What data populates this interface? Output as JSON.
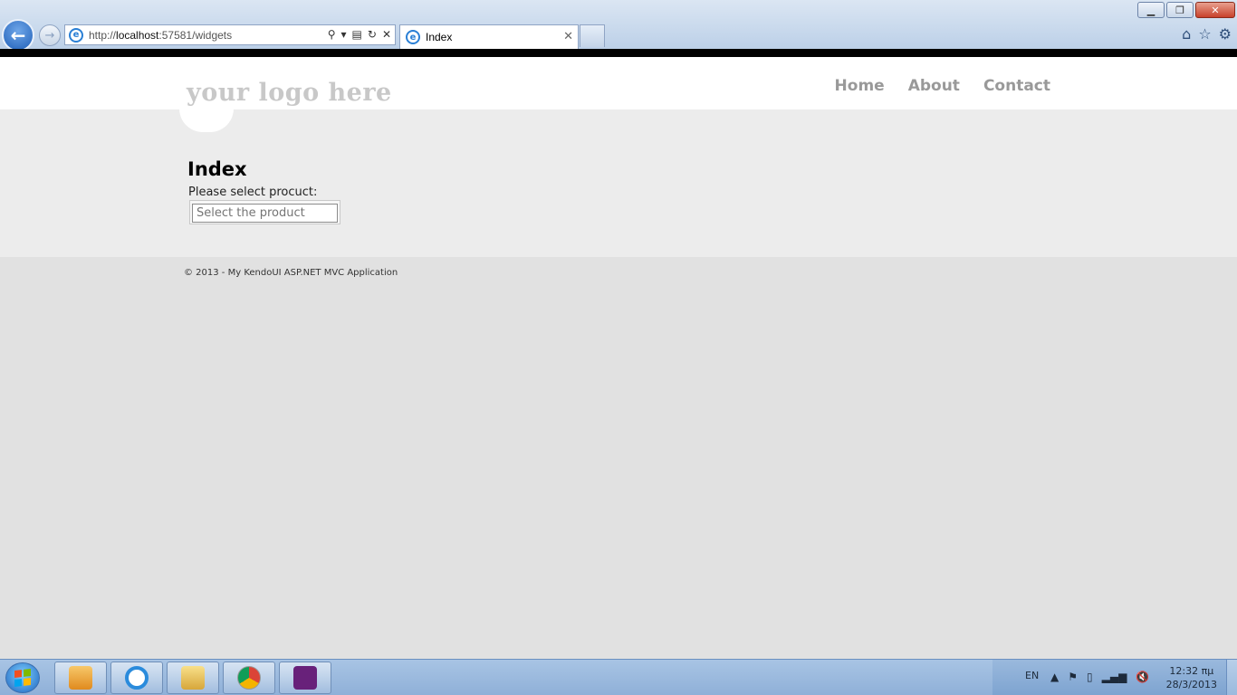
{
  "browser": {
    "url_prefix": "http://",
    "url_host": "localhost",
    "url_rest": ":57581/widgets",
    "tab_title": "Index"
  },
  "site": {
    "logo": "your logo here",
    "menu": [
      "Home",
      "About",
      "Contact"
    ]
  },
  "main": {
    "title": "Index",
    "label": "Please select procuct:",
    "select_placeholder": "Select the product"
  },
  "footer": {
    "text": "© 2013 - My KendoUI ASP.NET MVC Application"
  },
  "taskbar": {
    "lang": "EN",
    "time": "12:32 πμ",
    "date": "28/3/2013"
  }
}
